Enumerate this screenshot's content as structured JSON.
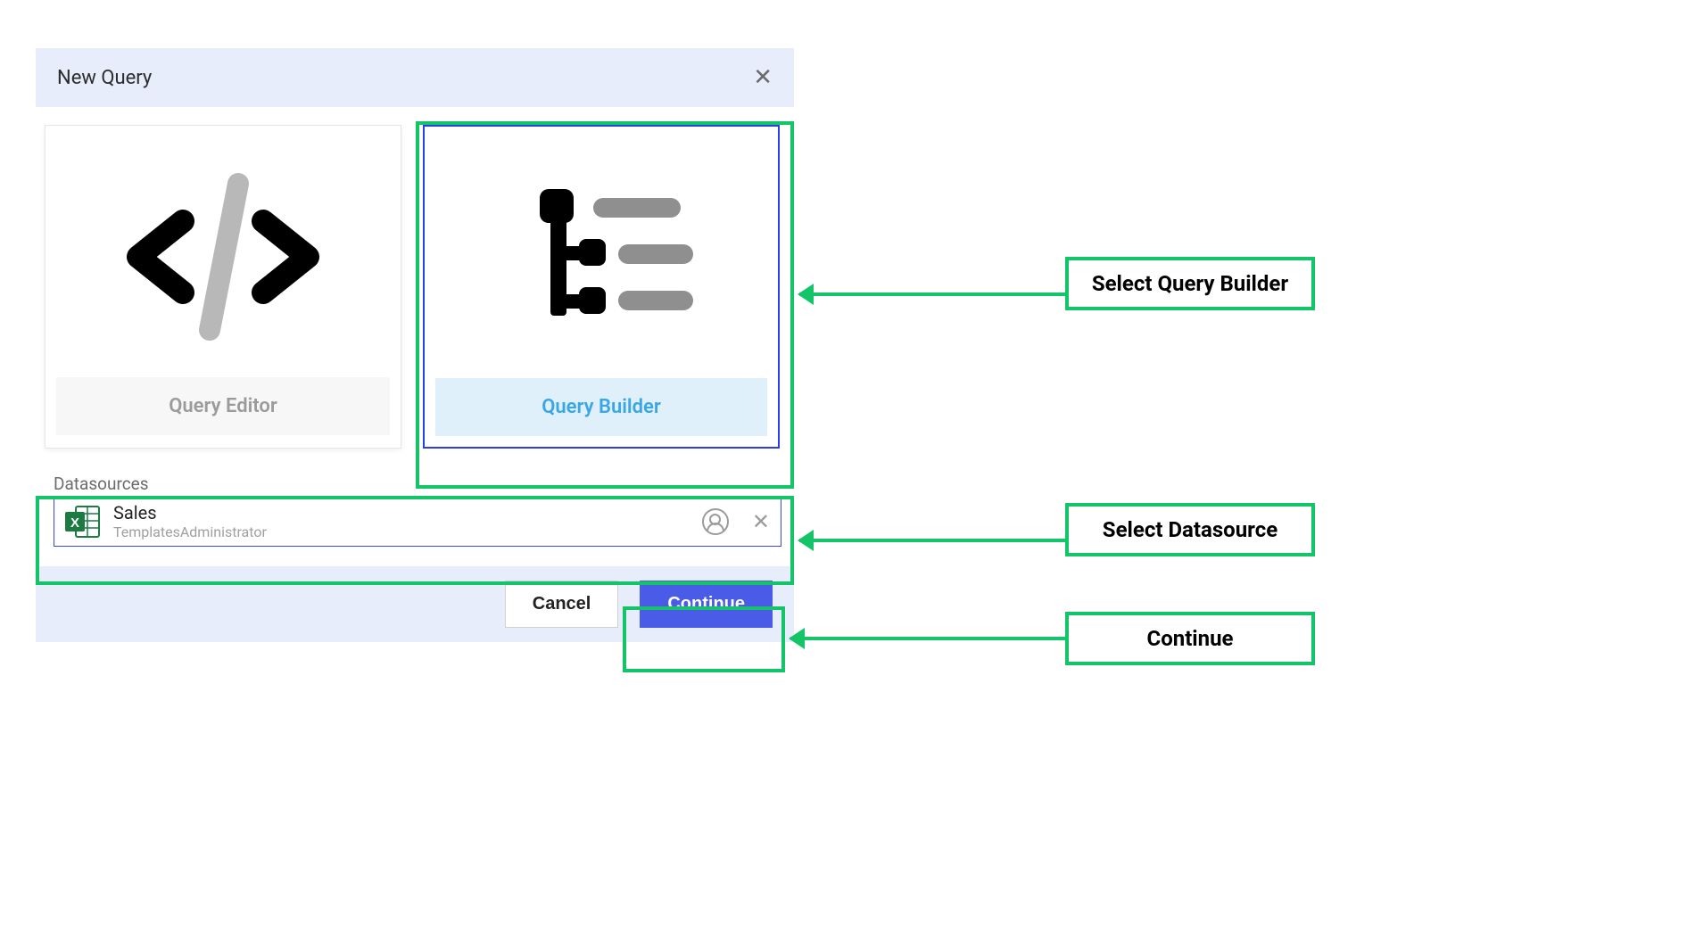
{
  "dialog": {
    "title": "New Query",
    "options": {
      "editor_label": "Query Editor",
      "builder_label": "Query Builder"
    },
    "datasources": {
      "section_label": "Datasources",
      "item": {
        "name": "Sales",
        "owner": "TemplatesAdministrator"
      }
    },
    "footer": {
      "cancel_label": "Cancel",
      "continue_label": "Continue"
    }
  },
  "annotations": {
    "select_builder": "Select Query Builder",
    "select_datasource": "Select Datasource",
    "continue": "Continue"
  }
}
